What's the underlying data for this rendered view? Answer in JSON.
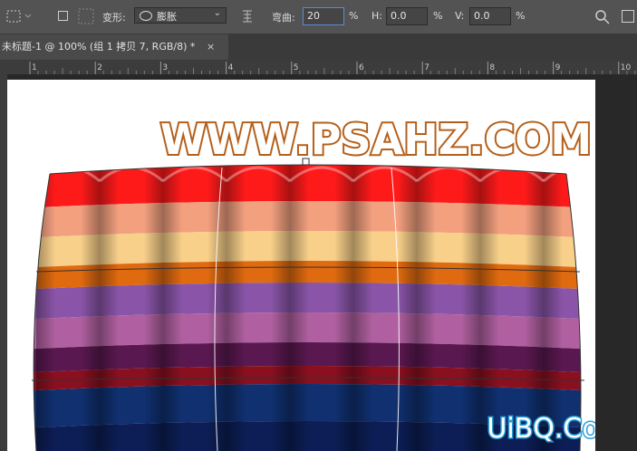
{
  "options": {
    "transform_label": "变形:",
    "warp_style": "膨胀",
    "bend_label": "弯曲:",
    "bend_value": "20",
    "bend_unit": "%",
    "h_label": "H:",
    "h_value": "0.0",
    "h_unit": "%",
    "v_label": "V:",
    "v_value": "0.0",
    "v_unit": "%"
  },
  "doc_tab": {
    "title": "未标题-1 @ 100% (组 1 拷贝 7, RGB/8) *",
    "close": "×"
  },
  "ruler": {
    "labels": [
      "1",
      "2",
      "3",
      "4",
      "5",
      "6",
      "7",
      "8",
      "9",
      "10"
    ]
  },
  "artwork": {
    "headline": "WWW.PSAHZ.COM",
    "watermark": "UiBQ.CoM",
    "stripe_colors": [
      "#ff1a1a",
      "#f3a07f",
      "#f8d08a",
      "#e06a10",
      "#8a55a8",
      "#b060a0",
      "#5a1850",
      "#8a1020",
      "#103070",
      "#0c1e55"
    ]
  }
}
